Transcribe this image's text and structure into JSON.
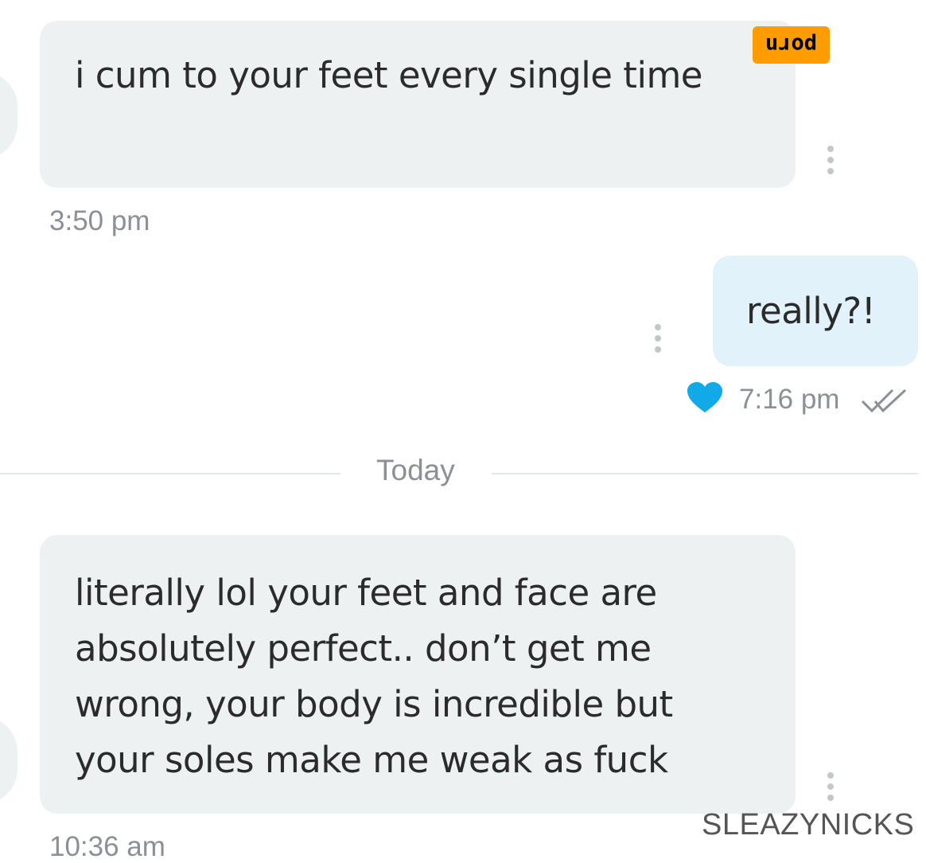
{
  "messages": [
    {
      "direction": "incoming",
      "text": "i cum to your feet every single time",
      "time": "3:50 pm"
    },
    {
      "direction": "outgoing",
      "text": "really?!",
      "time": "7:16 pm",
      "reaction_icon": "heart-icon",
      "status_icon": "double-check-icon"
    },
    {
      "direction": "incoming",
      "text": "literally lol your feet and face are absolutely perfect.. don’t get me wrong, your body is incredible but your soles make me weak as fuck",
      "time": "10:36 am"
    }
  ],
  "date_divider": {
    "label": "Today"
  },
  "badge": {
    "text": "porn",
    "color": "#ff9d00"
  },
  "watermark": {
    "text": "SLEAZYNICKS"
  },
  "colors": {
    "incoming_bubble": "#eef1f2",
    "outgoing_bubble": "#e1f2fb",
    "heart": "#12a9e8",
    "secondary_text": "#8a9095"
  },
  "icons": [
    "more-options-icon",
    "heart-icon",
    "double-check-icon"
  ]
}
